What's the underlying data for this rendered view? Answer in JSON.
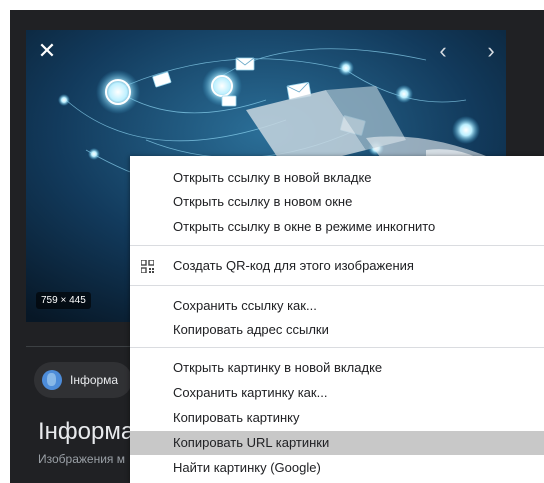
{
  "viewer": {
    "close_icon": "close-icon",
    "prev_icon": "chevron-left-icon",
    "next_icon": "chevron-right-icon",
    "image_dimensions": "759 × 445"
  },
  "page": {
    "source_label": "Інформа",
    "title": "Інформац",
    "subtitle": "Изображения м"
  },
  "context_menu": {
    "groups": [
      [
        "Открыть ссылку в новой вкладке",
        "Открыть ссылку в новом окне",
        "Открыть ссылку в окне в режиме инкогнито"
      ],
      [
        "Создать QR-код для этого изображения"
      ],
      [
        "Сохранить ссылку как...",
        "Копировать адрес ссылки"
      ],
      [
        "Открыть картинку в новой вкладке",
        "Сохранить картинку как...",
        "Копировать картинку",
        "Копировать URL картинки",
        "Найти картинку (Google)"
      ]
    ],
    "highlighted_item": "Копировать URL картинки",
    "qr_icon": "qr-code-icon"
  },
  "colors": {
    "panel_bg": "#202124",
    "menu_bg": "#ffffff",
    "highlight": "#c8c8c8",
    "accent_glow": "#7fd3f2"
  }
}
